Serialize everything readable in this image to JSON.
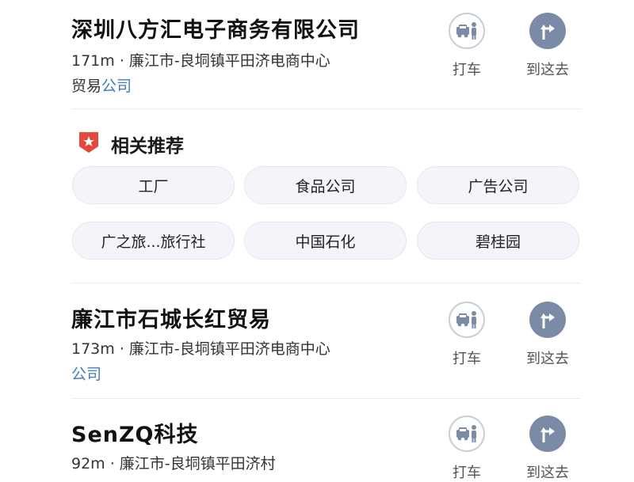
{
  "results": [
    {
      "name": "深圳八方汇电子商务有限公司",
      "distance_address": "171m · 廉江市-良垌镇平田济电商中心",
      "category_prefix": "贸易",
      "category_link": "公司"
    },
    {
      "name": "廉江市石城长红贸易",
      "distance_address": "173m · 廉江市-良垌镇平田济电商中心",
      "category_prefix": "",
      "category_link": "公司"
    },
    {
      "name": "SenZQ科技",
      "distance_address": "92m · 廉江市-良垌镇平田济村",
      "category_prefix": "",
      "category_link": ""
    }
  ],
  "actions": {
    "taxi_label": "打车",
    "go_label": "到这去",
    "taxi_icon": "taxi-icon",
    "go_icon": "turn-right-arrow-icon"
  },
  "recommend": {
    "title": "相关推荐",
    "icon": "star-badge-icon",
    "badge_color": "#e8453c",
    "chips": [
      "工厂",
      "食品公司",
      "广告公司",
      "广之旅...旅行社",
      "中国石化",
      "碧桂园"
    ]
  },
  "colors": {
    "link": "#3b7bd9",
    "nav_button": "#7b8aa6"
  }
}
